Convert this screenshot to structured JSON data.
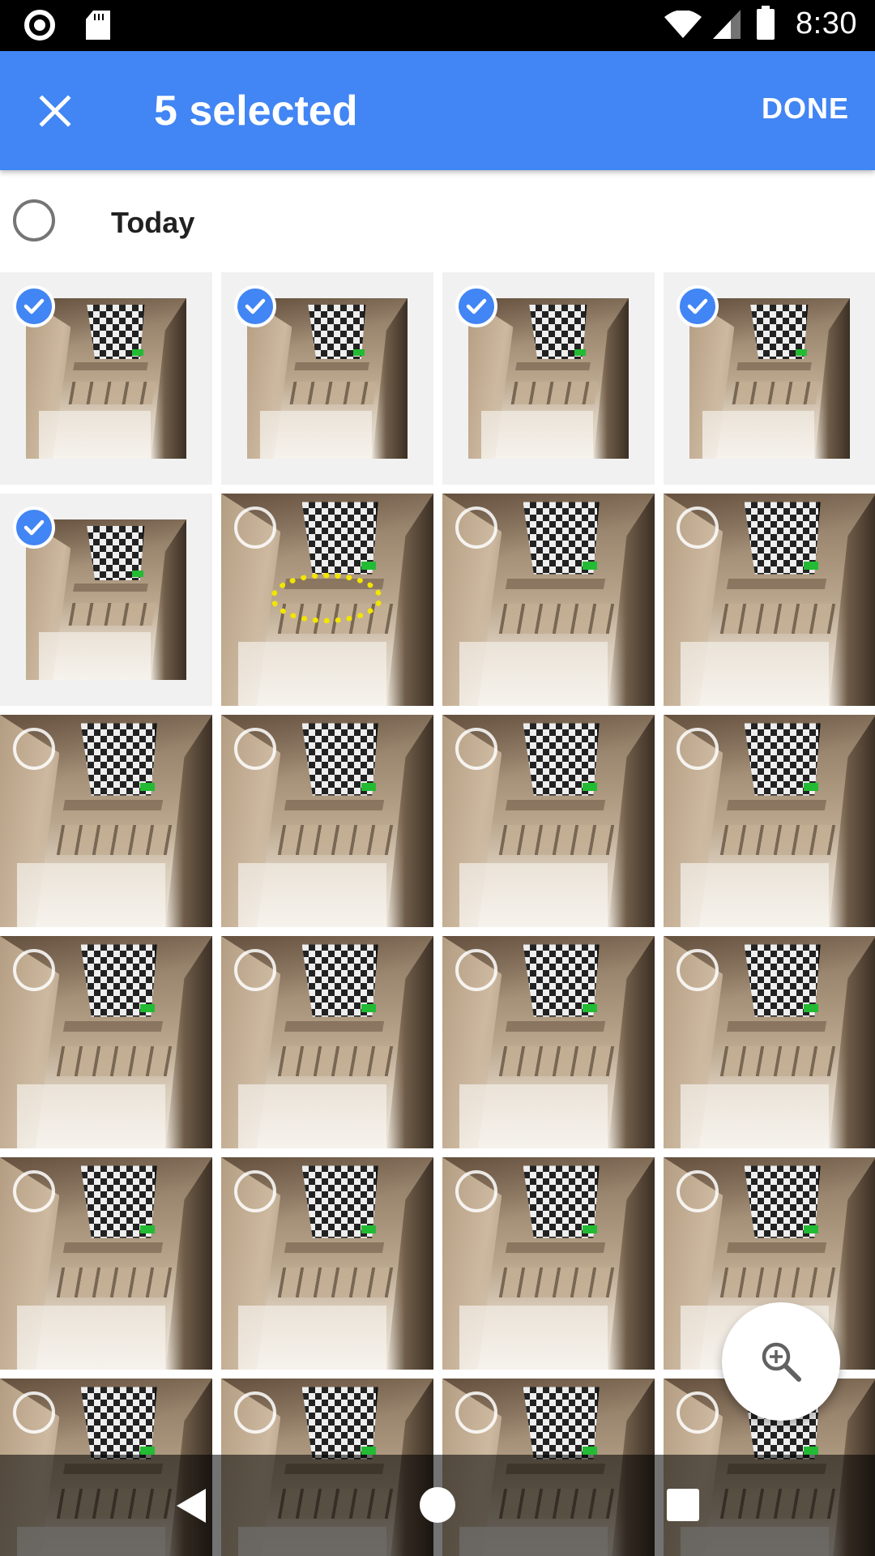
{
  "status_bar": {
    "time": "8:30",
    "icons": [
      "record-icon",
      "sd-card-icon",
      "wifi-icon",
      "cell-signal-icon",
      "battery-icon"
    ]
  },
  "app_bar": {
    "title": "5 selected",
    "done_label": "DONE",
    "close_icon": "close-icon",
    "color": "#4285f4"
  },
  "section": {
    "title": "Today"
  },
  "photos": [
    {
      "selected": true
    },
    {
      "selected": true
    },
    {
      "selected": true
    },
    {
      "selected": true
    },
    {
      "selected": true
    },
    {
      "selected": false
    },
    {
      "selected": false
    },
    {
      "selected": false
    },
    {
      "selected": false
    },
    {
      "selected": false
    },
    {
      "selected": false
    },
    {
      "selected": false
    },
    {
      "selected": false
    },
    {
      "selected": false
    },
    {
      "selected": false
    },
    {
      "selected": false
    },
    {
      "selected": false
    },
    {
      "selected": false
    },
    {
      "selected": false
    },
    {
      "selected": false
    },
    {
      "selected": false
    },
    {
      "selected": false
    },
    {
      "selected": false
    },
    {
      "selected": false
    }
  ],
  "fab": {
    "icon": "zoom-in-icon"
  },
  "nav_bar": {
    "icons": [
      "back-icon",
      "home-icon",
      "recents-icon"
    ]
  },
  "colors": {
    "accent": "#4285f4",
    "annotation": "#f2e600"
  }
}
